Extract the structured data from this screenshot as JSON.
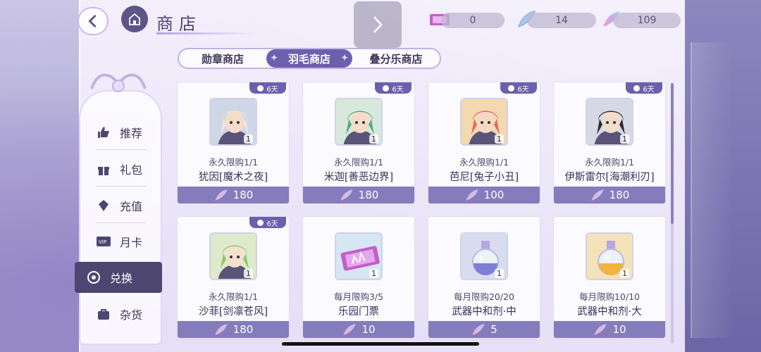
{
  "header": {
    "title": "商店",
    "back_icon": "back-arrow-icon",
    "home_icon": "castle-icon"
  },
  "currencies": [
    {
      "icon": "ticket-icon",
      "value": "0"
    },
    {
      "icon": "blue-feather-icon",
      "value": "14"
    },
    {
      "icon": "rainbow-feather-icon",
      "value": "109"
    }
  ],
  "tabs": [
    {
      "label": "勋章商店"
    },
    {
      "label": "羽毛商店",
      "active": true
    },
    {
      "label": "叠分乐商店"
    }
  ],
  "sidebar": {
    "items": [
      {
        "label": "推荐",
        "icon": "thumbs-up-icon"
      },
      {
        "label": "礼包",
        "icon": "gift-icon"
      },
      {
        "label": "充值",
        "icon": "crystal-icon"
      },
      {
        "label": "月卡",
        "icon": "vip-card-icon"
      },
      {
        "label": "兑换",
        "icon": "exchange-icon",
        "active": true
      },
      {
        "label": "杂货",
        "icon": "bag-icon"
      }
    ]
  },
  "items": [
    {
      "badge": "6天",
      "limit": "永久限购1/1",
      "name": "犹因[魔术之夜]",
      "price": "180",
      "qty": "1",
      "kind": "portrait",
      "hair": "#e6e6ee",
      "skin": "#f4dcc8",
      "bg": "#cfd6e6"
    },
    {
      "badge": "6天",
      "limit": "永久限购1/1",
      "name": "米迦[善恶边界]",
      "price": "180",
      "qty": "1",
      "kind": "portrait",
      "hair": "#4fae86",
      "skin": "#f4dcc8",
      "bg": "#d8e8dc"
    },
    {
      "badge": "6天",
      "limit": "永久限购1/1",
      "name": "芭尼[兔子小丑]",
      "price": "100",
      "qty": "1",
      "kind": "portrait",
      "hair": "#e06a5a",
      "skin": "#f6d8c4",
      "bg": "#f4d8b0"
    },
    {
      "badge": "6天",
      "limit": "永久限购1/1",
      "name": "伊斯雷尔[海潮利刃]",
      "price": "180",
      "qty": "1",
      "kind": "portrait",
      "hair": "#2e2a3a",
      "skin": "#f2dccc",
      "bg": "#d6d8e6"
    },
    {
      "badge": "6天",
      "limit": "永久限购1/1",
      "name": "沙菲[剑凛苍风]",
      "price": "180",
      "qty": "1",
      "kind": "portrait",
      "hair": "#8cc86a",
      "skin": "#f4e0cc",
      "bg": "#dfe9cc"
    },
    {
      "badge": "",
      "limit": "每月限购3/5",
      "name": "乐园门票",
      "price": "10",
      "qty": "1",
      "kind": "ticket",
      "bg": "#d6e6f2"
    },
    {
      "badge": "",
      "limit": "每月限购20/20",
      "name": "武器中和剂·中",
      "price": "5",
      "qty": "1",
      "kind": "potion",
      "liquid": "#7e7ed6",
      "bg": "#d8dcee"
    },
    {
      "badge": "",
      "limit": "每月限购10/10",
      "name": "武器中和剂·大",
      "price": "10",
      "qty": "1",
      "kind": "potion",
      "liquid": "#f0b43c",
      "bg": "#f4e2b8"
    }
  ],
  "price_icon": "feather-icon",
  "colors": {
    "accent": "#6c5fae",
    "price_bar": "#857cbc",
    "sidebar_active": "#4d4670"
  }
}
